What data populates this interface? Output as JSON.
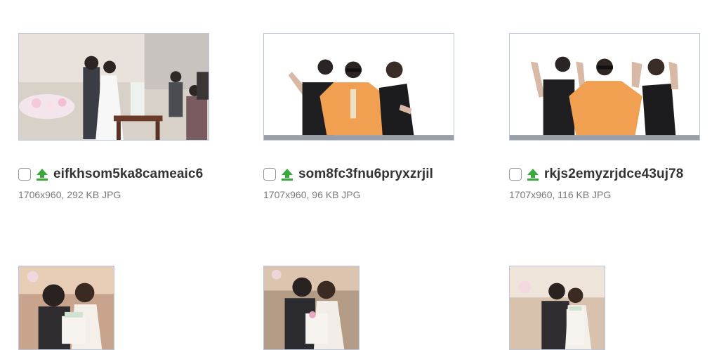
{
  "files": [
    {
      "name": "eifkhsom5ka8cameaic6",
      "details": "1706x960, 292 KB JPG"
    },
    {
      "name": "som8fc3fnu6pryxzrjil",
      "details": "1707x960, 96 KB JPG"
    },
    {
      "name": "rkjs2emyzrjdce43uj78",
      "details": "1707x960, 116 KB JPG"
    }
  ],
  "icons": {
    "upload": "upload-arrow-icon",
    "checkbox": "checkbox-icon"
  },
  "colors": {
    "upload_green": "#3aa83a",
    "thumb_border": "#b9c6dc",
    "robe_orange": "#f0a050"
  }
}
